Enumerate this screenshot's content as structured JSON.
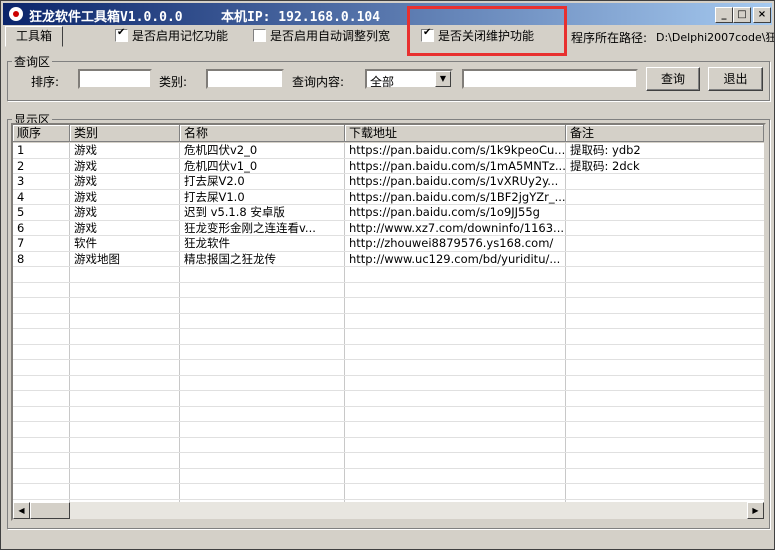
{
  "titlebar": {
    "title": "狂龙软件工具箱V1.0.0.0",
    "ip": "本机IP: 192.168.0.104",
    "minimize_label": "_",
    "maximize_label": "□",
    "close_label": "×"
  },
  "toolbar": {
    "tab_label": "工具箱",
    "remember_checkbox": {
      "label": "是否启用记忆功能",
      "checked": true
    },
    "autowidth_checkbox": {
      "label": "是否启用自动调整列宽",
      "checked": false
    },
    "maintenance_checkbox": {
      "label": "是否关闭维护功能",
      "checked": true
    },
    "path_label": "程序所在路径:",
    "path_value": "D:\\Delphi2007code\\狂"
  },
  "query": {
    "group_title": "查询区",
    "sort_label": "排序:",
    "sort_value": "",
    "category_label": "类别:",
    "category_value": "",
    "content_label": "查询内容:",
    "content_select_value": "全部",
    "content_text_value": "",
    "search_button": "查询",
    "exit_button": "退出"
  },
  "display": {
    "group_title": "显示区",
    "columns": [
      "顺序",
      "类别",
      "名称",
      "下载地址",
      "备注"
    ],
    "rows": [
      [
        "1",
        "游戏",
        "危机四伏v2_0",
        "https://pan.baidu.com/s/1k9kpeoCu...",
        "提取码: ydb2"
      ],
      [
        "2",
        "游戏",
        "危机四伏v1_0",
        "https://pan.baidu.com/s/1mA5MNTz...",
        "提取码: 2dck"
      ],
      [
        "3",
        "游戏",
        "打去屎V2.0",
        "https://pan.baidu.com/s/1vXRUy2y...",
        ""
      ],
      [
        "4",
        "游戏",
        "打去屎V1.0",
        "https://pan.baidu.com/s/1BF2jgYZr_...",
        ""
      ],
      [
        "5",
        "游戏",
        "迟到 v5.1.8 安卓版",
        "https://pan.baidu.com/s/1o9JJ55g",
        ""
      ],
      [
        "6",
        "游戏",
        "狂龙变形金刚之连连看v...",
        "http://www.xz7.com/downinfo/1163...",
        ""
      ],
      [
        "7",
        "软件",
        "狂龙软件",
        "http://zhouwei8879576.ys168.com/",
        ""
      ],
      [
        "8",
        "游戏地图",
        "精忠报国之狂龙传",
        "http://www.uc129.com/bd/yuriditu/...",
        ""
      ]
    ]
  },
  "colors": {
    "highlight": "#e8302f",
    "titlebar_start": "#0a246a",
    "titlebar_end": "#a6caf0"
  }
}
